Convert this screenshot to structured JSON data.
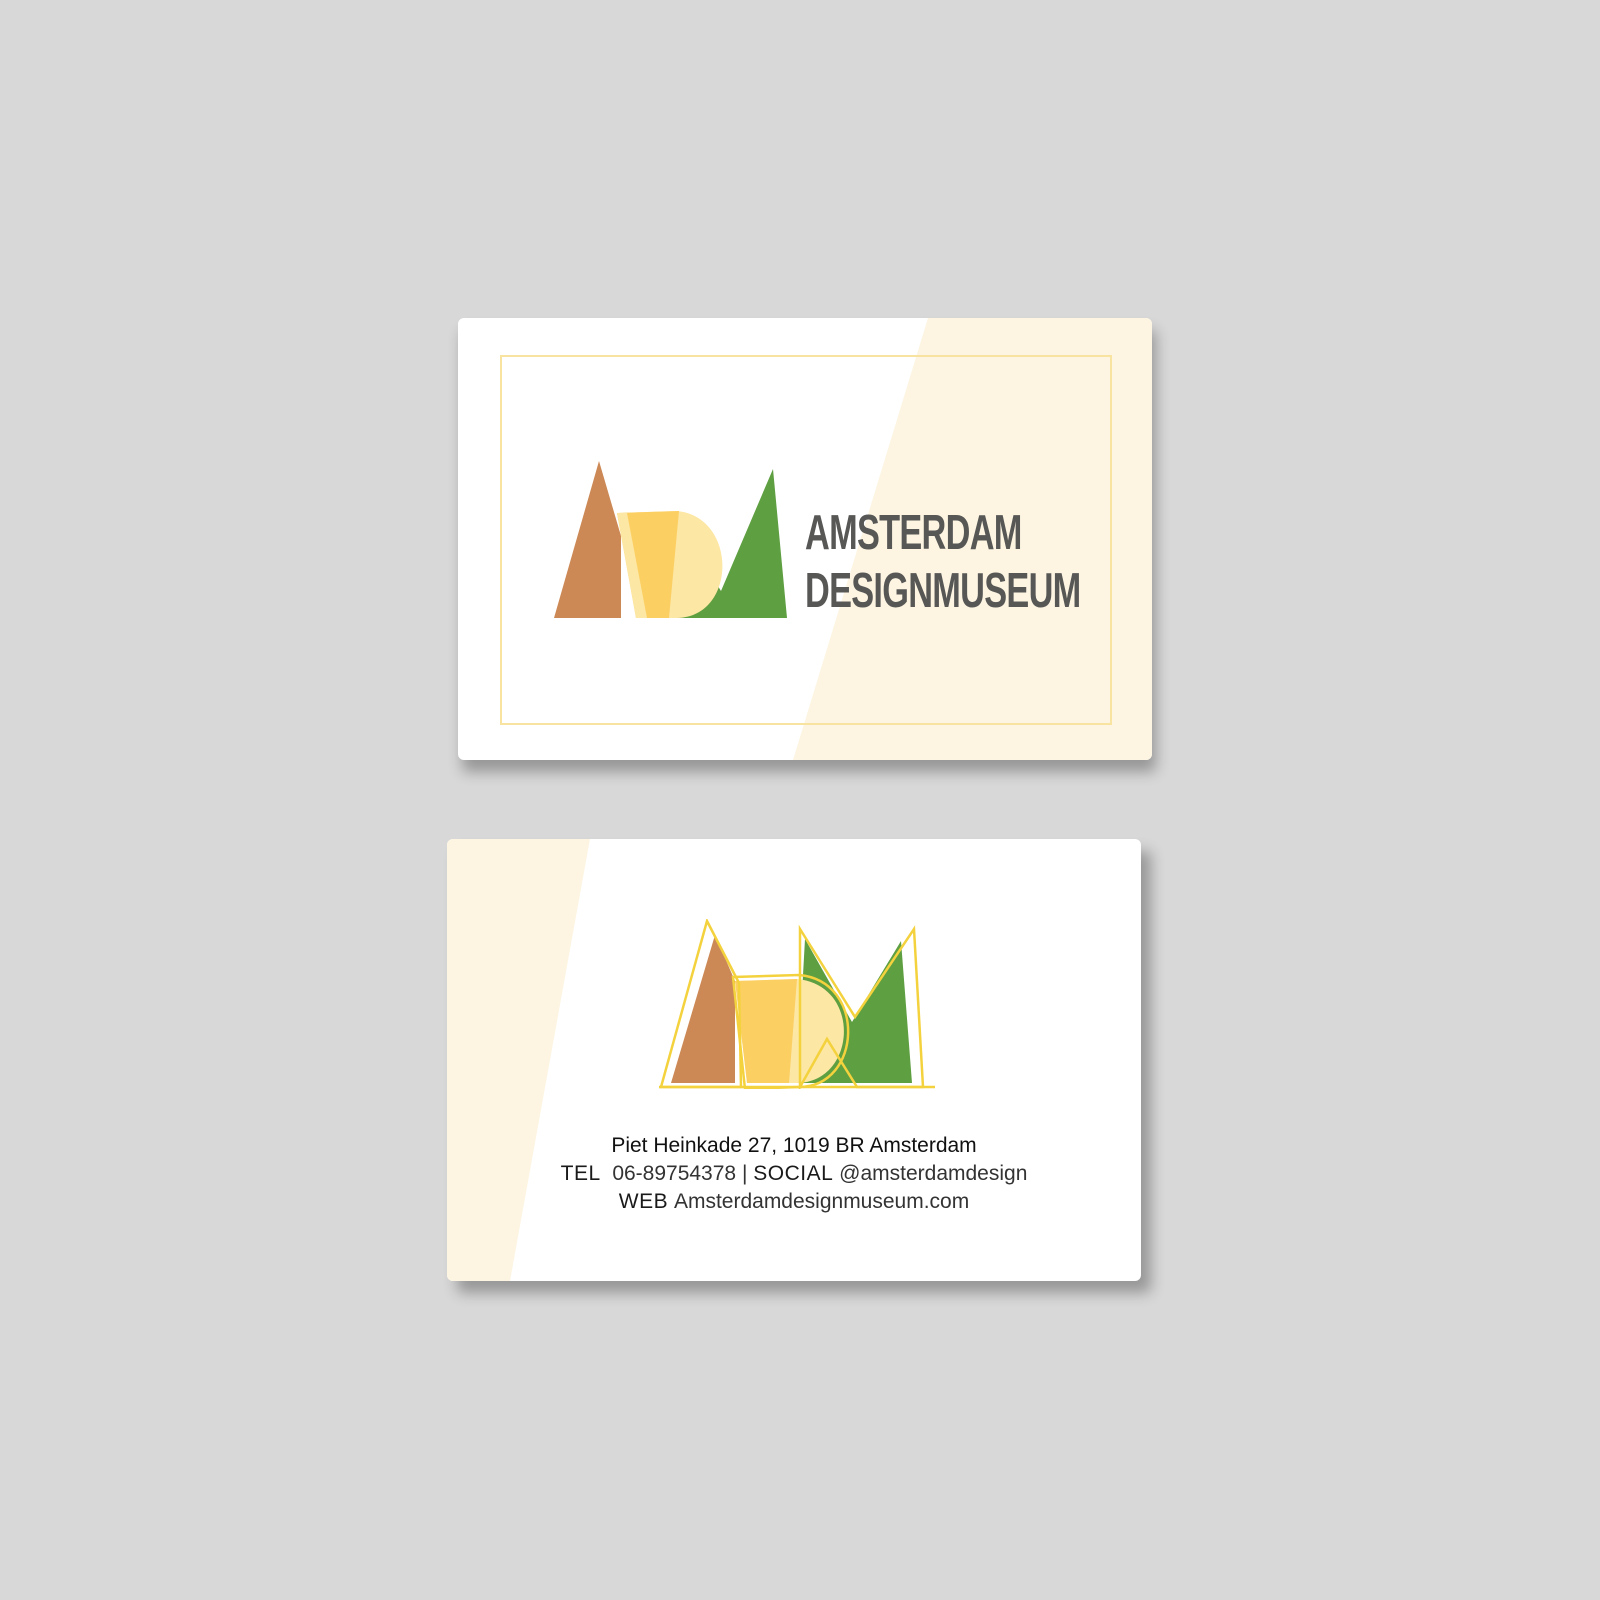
{
  "colors": {
    "background": "#d8d8d8",
    "card": "#ffffff",
    "tint": "#fdf5e2",
    "frame": "#f8e4a0",
    "brown": "#cc8855",
    "yellow": "#fccf63",
    "pale_yellow": "#fde7a4",
    "green": "#5e9f41",
    "outline": "#f4d23e",
    "wordmark": "#575756"
  },
  "front": {
    "wordmark_line1": "AMSTERDAM",
    "wordmark_line2": "DESIGNMUSEUM",
    "logo": "adm-monogram-logo"
  },
  "back": {
    "logo": "adm-monogram-outline-logo",
    "address": "Piet Heinkade 27, 1019 BR Amsterdam",
    "tel_label": "TEL",
    "tel_value": "06-89754378",
    "separator": "|",
    "social_label": "SOCIAL",
    "social_value": "@amsterdamdesign",
    "web_label": "WEB",
    "web_value": "Amsterdamdesignmuseum.com"
  }
}
